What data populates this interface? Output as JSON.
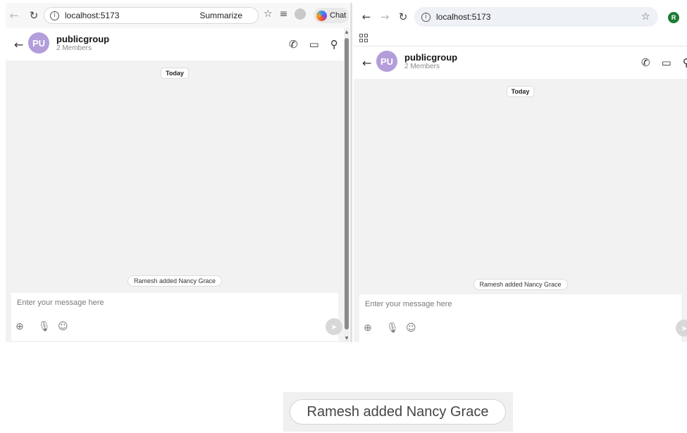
{
  "left_browser": {
    "url": "localhost:5173",
    "summarize_label": "Summarize",
    "copilot_label": "Chat"
  },
  "right_browser": {
    "url": "localhost:5173",
    "profile_initial": "R"
  },
  "chat": {
    "avatar_initials": "PU",
    "group_name": "publicgroup",
    "members": "2 Members",
    "date_separator": "Today",
    "system_message": "Ramesh added Nancy Grace",
    "input_placeholder": "Enter your message here"
  },
  "zoom_callout": {
    "text": "Ramesh added Nancy Grace"
  },
  "colors": {
    "avatar_bg": "#b39ddb",
    "chat_bg": "#f2f2f2",
    "chrome_profile": "#1e7b34"
  }
}
